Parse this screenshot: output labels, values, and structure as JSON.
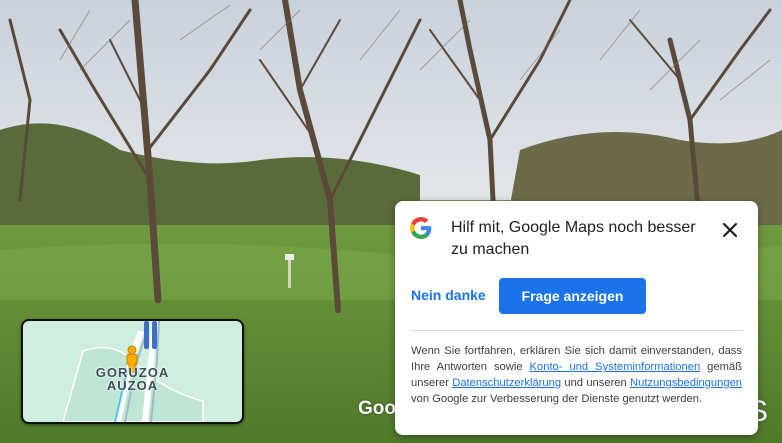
{
  "street_view": {
    "watermark": "Google",
    "watermark_right": "S"
  },
  "minimap": {
    "place_label_line1": "GORUZOA",
    "place_label_line2": "AUZOA"
  },
  "survey_dialog": {
    "title": "Hilf mit, Google Maps noch besser zu machen",
    "decline_label": "Nein danke",
    "accept_label": "Frage anzeigen",
    "disclaimer_part1": "Wenn Sie fortfahren, erklären Sie sich damit einverstanden, dass Ihre Antworten sowie",
    "link_account": "Konto- und Systeminformationen",
    "disclaimer_part2": "gemäß unserer",
    "link_privacy": "Datenschutzerklärung",
    "disclaimer_part3": "und unseren",
    "link_terms": "Nutzungsbedingungen",
    "disclaimer_part4": "von Google zur Verbesserung der Dienste genutzt werden."
  },
  "colors": {
    "accent": "#1a73e8",
    "dialog_bg": "#ffffff",
    "minimap_bg": "#cfeee0"
  },
  "icons": [
    "google-g-icon",
    "close-icon",
    "pegman-icon"
  ]
}
